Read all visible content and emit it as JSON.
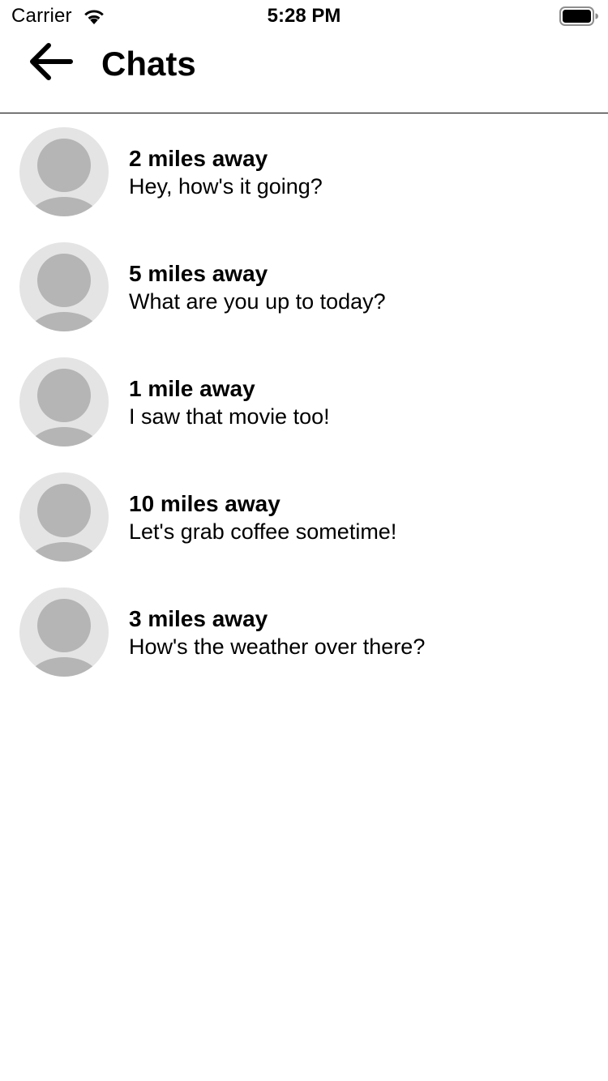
{
  "status_bar": {
    "carrier": "Carrier",
    "time": "5:28 PM",
    "wifi_icon": "wifi-icon",
    "battery_icon": "battery-full-icon"
  },
  "header": {
    "back_icon": "arrow-left-icon",
    "title": "Chats"
  },
  "chats": [
    {
      "distance": "2 miles away",
      "message": "Hey, how's it going?"
    },
    {
      "distance": "5 miles away",
      "message": "What are you up to today?"
    },
    {
      "distance": "1 mile away",
      "message": "I saw that movie too!"
    },
    {
      "distance": "10 miles away",
      "message": "Let's grab coffee sometime!"
    },
    {
      "distance": "3 miles away",
      "message": "How's the weather over there?"
    }
  ],
  "colors": {
    "avatar_background": "#e4e4e4",
    "avatar_silhouette": "#b5b5b5",
    "divider": "#000000"
  }
}
